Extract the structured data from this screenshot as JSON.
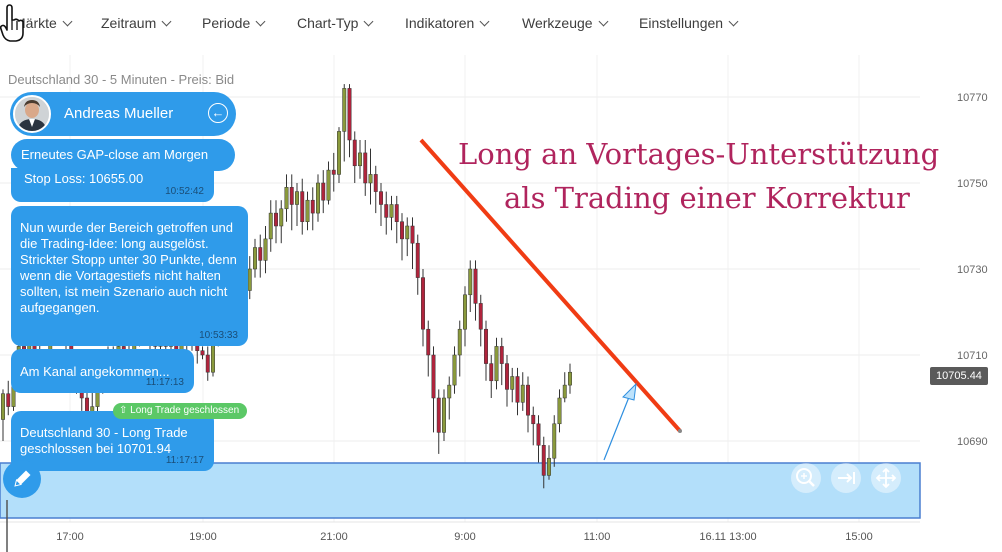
{
  "menu": {
    "items": [
      {
        "label": "Märkte"
      },
      {
        "label": "Zeitraum"
      },
      {
        "label": "Periode"
      },
      {
        "label": "Chart-Typ"
      },
      {
        "label": "Indikatoren"
      },
      {
        "label": "Werkzeuge"
      },
      {
        "label": "Einstellungen"
      }
    ]
  },
  "chart": {
    "title": "Deutschland 30 - 5 Minuten - Preis: Bid",
    "current_price": "10705.44",
    "current_price_value": 10705.44,
    "price_ticks": [
      "10770",
      "10750",
      "10730",
      "10710",
      "10690"
    ],
    "time_ticks": [
      "17:00",
      "19:00",
      "21:00",
      "9:00",
      "11:00",
      "16.11 13:00",
      "15:00"
    ],
    "up_color": "#8a9a3c",
    "down_color": "#b0243c",
    "trendline_color": "#f03c14",
    "zone_color": "#b3dffa",
    "annotation": {
      "line1": "Long an Vortages-Unterstützung",
      "line2": "als Trading einer Korrektur",
      "color": "#b0245d"
    }
  },
  "chart_data": {
    "type": "candlestick",
    "title": "Deutschland 30 - 5 Minuten - Preis: Bid",
    "y_ticks": [
      10770,
      10750,
      10730,
      10710,
      10690
    ],
    "x_ticks": [
      "17:00",
      "19:00",
      "21:00",
      "9:00",
      "11:00",
      "16.11 13:00",
      "15:00"
    ],
    "current_price": 10705.44,
    "support_zone": [
      10675,
      10688
    ],
    "candles": [
      [
        10695,
        10701,
        10690,
        10702
      ],
      [
        10701,
        10698,
        10696,
        10704
      ],
      [
        10698,
        10707,
        10697,
        10709
      ],
      [
        10707,
        10712,
        10705,
        10714
      ],
      [
        10712,
        10708,
        10706,
        10714
      ],
      [
        10708,
        10714,
        10706,
        10716
      ],
      [
        10714,
        10711,
        10708,
        10716
      ],
      [
        10711,
        10705,
        10703,
        10713
      ],
      [
        10705,
        10709,
        10702,
        10711
      ],
      [
        10709,
        10716,
        10707,
        10718
      ],
      [
        10716,
        10720,
        10713,
        10722
      ],
      [
        10720,
        10717,
        10714,
        10722
      ],
      [
        10717,
        10713,
        10710,
        10719
      ],
      [
        10713,
        10708,
        10705,
        10715
      ],
      [
        10708,
        10704,
        10701,
        10710
      ],
      [
        10704,
        10700,
        10697,
        10706
      ],
      [
        10700,
        10694,
        10692,
        10702
      ],
      [
        10694,
        10698,
        10692,
        10704
      ],
      [
        10698,
        10703,
        10696,
        10705
      ],
      [
        10703,
        10708,
        10701,
        10710
      ],
      [
        10708,
        10710,
        10706,
        10712
      ],
      [
        10710,
        10708,
        10705,
        10712
      ],
      [
        10708,
        10712,
        10706,
        10714
      ],
      [
        10712,
        10709,
        10706,
        10714
      ],
      [
        10709,
        10711,
        10707,
        10713
      ],
      [
        10711,
        10714,
        10708,
        10716
      ],
      [
        10714,
        10716,
        10712,
        10718
      ],
      [
        10716,
        10718,
        10713,
        10720
      ],
      [
        10718,
        10714,
        10711,
        10720
      ],
      [
        10714,
        10712,
        10709,
        10716
      ],
      [
        10712,
        10715,
        10709,
        10717
      ],
      [
        10715,
        10712,
        10709,
        10717
      ],
      [
        10712,
        10715,
        10710,
        10717
      ],
      [
        10715,
        10711,
        10708,
        10717
      ],
      [
        10711,
        10713,
        10709,
        10715
      ],
      [
        10713,
        10716,
        10711,
        10718
      ],
      [
        10716,
        10713,
        10711,
        10718
      ],
      [
        10713,
        10711,
        10708,
        10715
      ],
      [
        10711,
        10710,
        10709,
        10712
      ],
      [
        10710,
        10706,
        10704,
        10712
      ],
      [
        10706,
        10713,
        10705,
        10715
      ],
      [
        10713,
        10719,
        10712,
        10721
      ],
      [
        10719,
        10721,
        10716,
        10723
      ],
      [
        10721,
        10726,
        10719,
        10728
      ],
      [
        10726,
        10723,
        10721,
        10729
      ],
      [
        10723,
        10729,
        10720,
        10731
      ],
      [
        10729,
        10725,
        10722,
        10731
      ],
      [
        10725,
        10730,
        10723,
        10733
      ],
      [
        10730,
        10735,
        10728,
        10737
      ],
      [
        10735,
        10732,
        10728,
        10738
      ],
      [
        10732,
        10737,
        10729,
        10740
      ],
      [
        10737,
        10743,
        10734,
        10746
      ],
      [
        10743,
        10740,
        10736,
        10746
      ],
      [
        10740,
        10744,
        10736,
        10746
      ],
      [
        10744,
        10749,
        10741,
        10752
      ],
      [
        10749,
        10745,
        10739,
        10752
      ],
      [
        10745,
        10748,
        10740,
        10750
      ],
      [
        10748,
        10741,
        10738,
        10751
      ],
      [
        10741,
        10746,
        10739,
        10748
      ],
      [
        10746,
        10743,
        10739,
        10749
      ],
      [
        10743,
        10750,
        10741,
        10752
      ],
      [
        10750,
        10746,
        10743,
        10753
      ],
      [
        10746,
        10753,
        10745,
        10755
      ],
      [
        10753,
        10752,
        10748,
        10757
      ],
      [
        10752,
        10762,
        10750,
        10763
      ],
      [
        10762,
        10772,
        10755,
        10773
      ],
      [
        10772,
        10760,
        10756,
        10773
      ],
      [
        10760,
        10754,
        10750,
        10762
      ],
      [
        10754,
        10757,
        10751,
        10760
      ],
      [
        10757,
        10750,
        10747,
        10760
      ],
      [
        10750,
        10752,
        10745,
        10758
      ],
      [
        10752,
        10748,
        10743,
        10754
      ],
      [
        10748,
        10745,
        10740,
        10750
      ],
      [
        10745,
        10742,
        10738,
        10748
      ],
      [
        10742,
        10745,
        10739,
        10747
      ],
      [
        10745,
        10741,
        10736,
        10747
      ],
      [
        10741,
        10737,
        10732,
        10743
      ],
      [
        10737,
        10740,
        10733,
        10742
      ],
      [
        10740,
        10736,
        10730,
        10742
      ],
      [
        10736,
        10728,
        10724,
        10738
      ],
      [
        10728,
        10716,
        10712,
        10730
      ],
      [
        10716,
        10710,
        10705,
        10718
      ],
      [
        10710,
        10700,
        10692,
        10712
      ],
      [
        10700,
        10692,
        10687,
        10702
      ],
      [
        10692,
        10700,
        10690,
        10702
      ],
      [
        10700,
        10703,
        10695,
        10705
      ],
      [
        10703,
        10710,
        10701,
        10712
      ],
      [
        10710,
        10716,
        10705,
        10718
      ],
      [
        10716,
        10724,
        10712,
        10726
      ],
      [
        10724,
        10730,
        10720,
        10732
      ],
      [
        10730,
        10722,
        10718,
        10732
      ],
      [
        10722,
        10716,
        10712,
        10724
      ],
      [
        10716,
        10708,
        10704,
        10718
      ],
      [
        10708,
        10704,
        10700,
        10710
      ],
      [
        10704,
        10712,
        10702,
        10714
      ],
      [
        10712,
        10708,
        10703,
        10714
      ],
      [
        10708,
        10702,
        10698,
        10710
      ],
      [
        10702,
        10705,
        10699,
        10707
      ],
      [
        10705,
        10699,
        10696,
        10707
      ],
      [
        10699,
        10703,
        10697,
        10706
      ],
      [
        10703,
        10696,
        10692,
        10705
      ],
      [
        10696,
        10694,
        10689,
        10698
      ],
      [
        10694,
        10689,
        10685,
        10696
      ],
      [
        10689,
        10682,
        10679,
        10691
      ],
      [
        10682,
        10686,
        10681,
        10689
      ],
      [
        10686,
        10694,
        10684,
        10696
      ],
      [
        10694,
        10700,
        10692,
        10702
      ],
      [
        10700,
        10703,
        10699,
        10706
      ],
      [
        10703,
        10706,
        10701,
        10708
      ]
    ],
    "trendline": {
      "from_price": 10765,
      "to_price": 10691
    },
    "arrow": {
      "from_price": 10686,
      "to_price": 10702
    }
  },
  "chat": {
    "user_name": "Andreas Mueller",
    "messages": [
      {
        "text": "Erneutes GAP-close am Morgen",
        "text2": "Stop Loss: 10655.00",
        "time": "10:52:42"
      },
      {
        "text": "Nun wurde der Bereich getroffen und die Trading-Idee: long ausgelöst. Strickter Stopp unter 30 Punkte, denn wenn die Vortagestiefs nicht halten sollten, ist mein Szenario auch nicht aufgegangen.",
        "time": "10:53:33"
      },
      {
        "text": "Am Kanal angekommen...",
        "time": "11:17:13"
      },
      {
        "badge": "Long Trade geschlossen",
        "text": "Deutschland 30 - Long Trade geschlossen bei 10701.94",
        "time": "11:17:17"
      }
    ]
  }
}
